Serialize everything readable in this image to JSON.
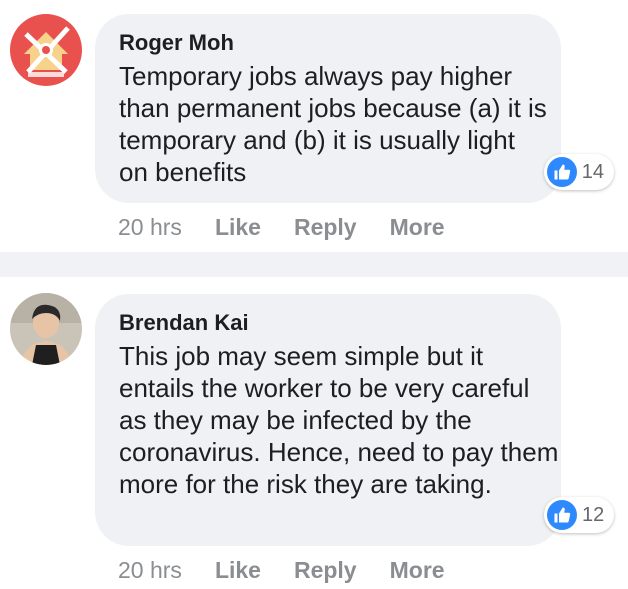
{
  "comments": [
    {
      "author": "Roger Moh",
      "text": "Temporary jobs always pay higher than permanent jobs because (a) it is temporary and (b) it is usually light on benefits",
      "reaction_count": "14",
      "time": "20 hrs",
      "like_label": "Like",
      "reply_label": "Reply",
      "more_label": "More"
    },
    {
      "author": "Brendan Kai",
      "text": "This job may seem simple but it entails the worker to be very careful as they may be infected by the coronavirus. Hence, need to pay them more for the risk they are taking.",
      "reaction_count": "12",
      "time": "20 hrs",
      "like_label": "Like",
      "reply_label": "Reply",
      "more_label": "More"
    }
  ],
  "colors": {
    "bubble": "#eff1f4",
    "like_blue": "#2e89ff",
    "meta_text": "#8a8d91",
    "divider": "#f0f2f5"
  }
}
